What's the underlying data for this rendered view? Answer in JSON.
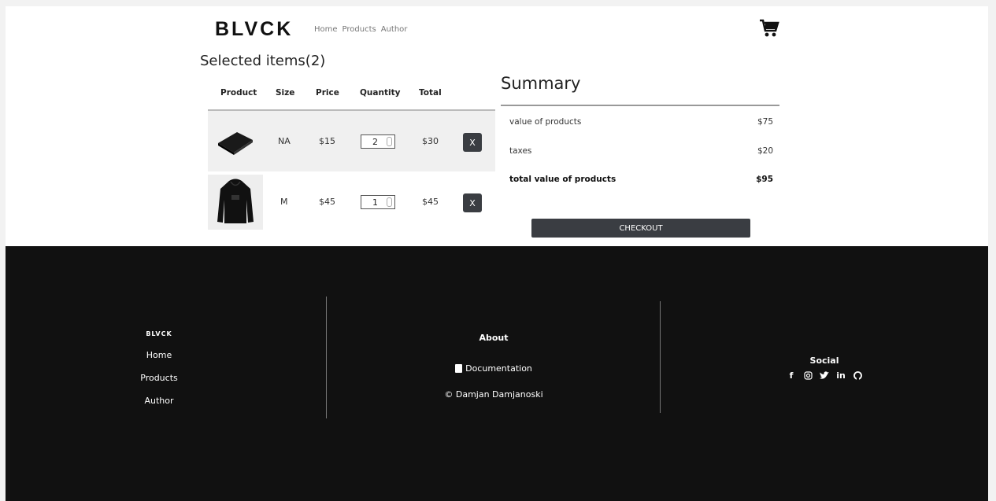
{
  "header": {
    "logo": "BLVCK",
    "nav": [
      "Home",
      "Products",
      "Author"
    ]
  },
  "cart": {
    "title": "Selected items(2)",
    "columns": [
      "Product",
      "Size",
      "Price",
      "Quantity",
      "Total"
    ],
    "items": [
      {
        "size": "NA",
        "price": "$15",
        "quantity": "2",
        "total": "$30",
        "remove": "X"
      },
      {
        "size": "M",
        "price": "$45",
        "quantity": "1",
        "total": "$45",
        "remove": "X"
      }
    ]
  },
  "summary": {
    "title": "Summary",
    "value_label": "value of products",
    "value": "$75",
    "taxes_label": "taxes",
    "taxes": "$20",
    "total_label": "total value of products",
    "total": "$95",
    "checkout": "CHECKOUT"
  },
  "footer": {
    "brand": "BLVCK",
    "links": [
      "Home",
      "Products",
      "Author"
    ],
    "about_title": "About",
    "documentation": "Documentation",
    "copyright": "© Damjan Damjanoski",
    "social_title": "Social",
    "social_icons": [
      "facebook-icon",
      "instagram-icon",
      "twitter-icon",
      "linkedin-icon",
      "github-icon"
    ]
  }
}
